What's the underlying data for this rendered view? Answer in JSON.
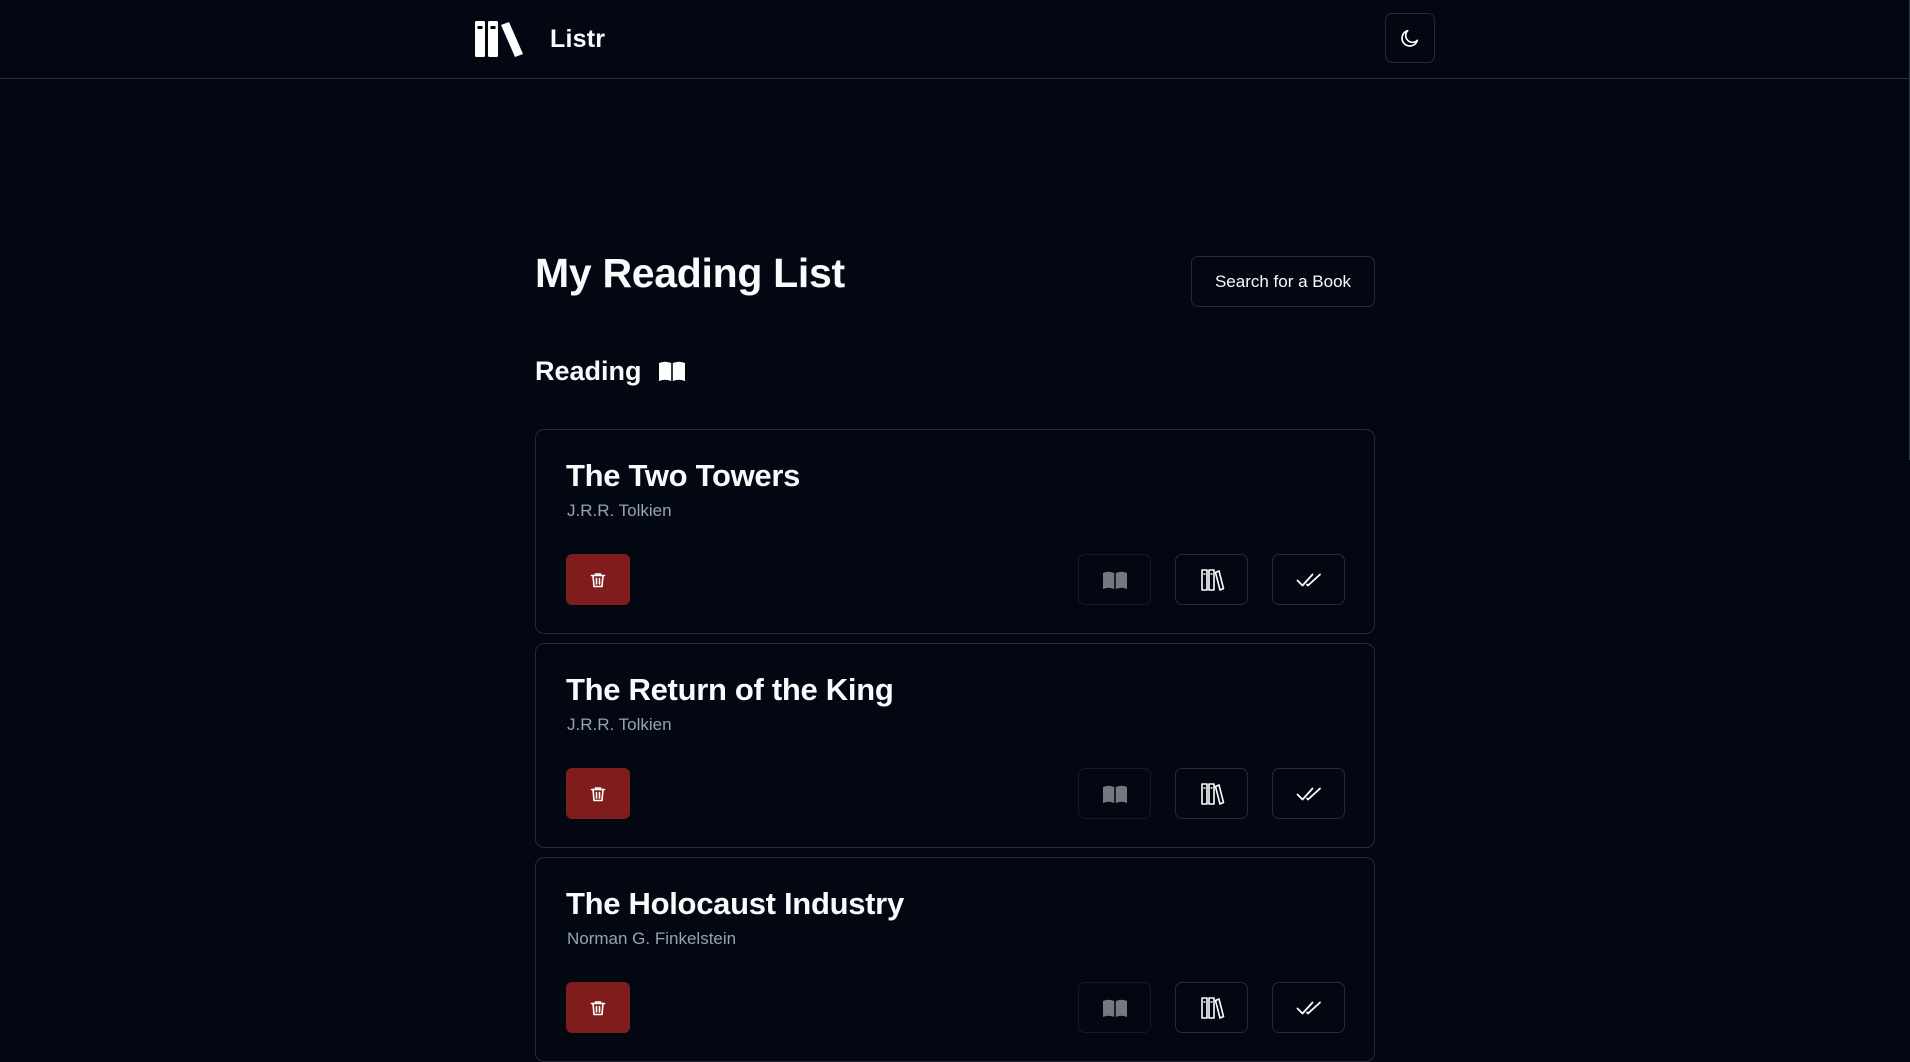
{
  "app": {
    "name": "Listr",
    "logo_icon": "books-icon",
    "theme_toggle_icon": "moon-icon"
  },
  "page": {
    "title": "My Reading List",
    "search_button_label": "Search for a Book"
  },
  "section": {
    "title": "Reading",
    "icon": "open-book-icon"
  },
  "books": [
    {
      "title": "The Two Towers",
      "author": "J.R.R. Tolkien"
    },
    {
      "title": "The Return of the King",
      "author": "J.R.R. Tolkien"
    },
    {
      "title": "The Holocaust Industry",
      "author": "Norman G. Finkelstein"
    }
  ],
  "card_actions": {
    "delete_icon": "trash-icon",
    "reading_icon": "open-book-icon",
    "shelf_icon": "bookshelf-icon",
    "done_icon": "double-check-icon"
  },
  "colors": {
    "background": "#030712",
    "border": "#252b36",
    "delete": "#7f1d1d",
    "muted_text": "#94a3b8"
  }
}
